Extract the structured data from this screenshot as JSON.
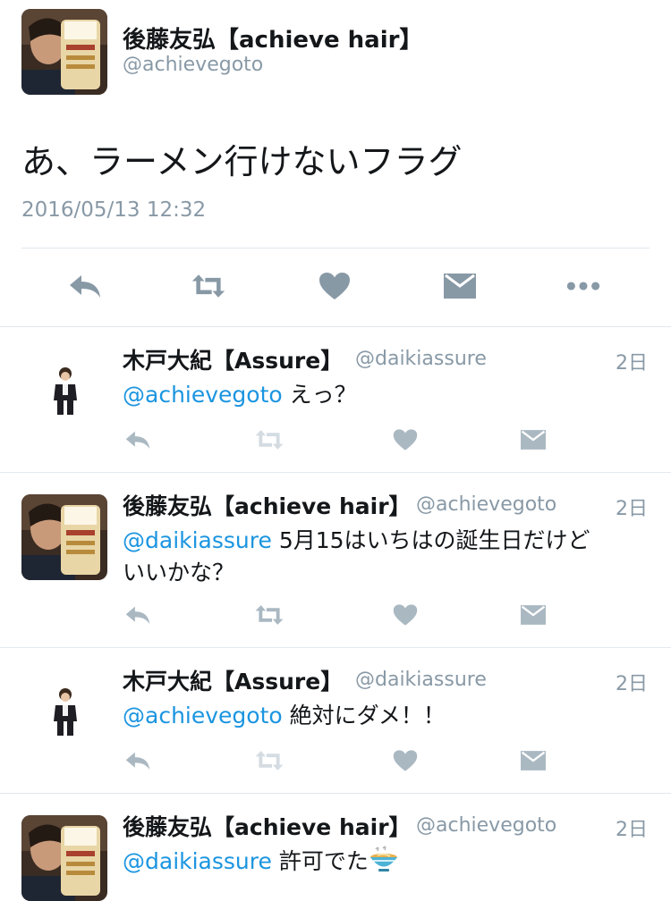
{
  "main_tweet": {
    "author_name": "後藤友弘【achieve hair】",
    "author_handle": "@achievegoto",
    "text": "あ、ラーメン行けないフラグ",
    "timestamp": "2016/05/13 12:32",
    "actions": [
      "reply-icon",
      "retweet-icon",
      "like-icon",
      "message-icon",
      "more-icon"
    ]
  },
  "replies": [
    {
      "author_name": "木戸大紀【Assure】",
      "author_handle": "@daikiassure",
      "age": "2日",
      "mention": "@achievegoto",
      "text": " えっ？"
    },
    {
      "author_name": "後藤友弘【achieve hair】",
      "author_handle": "@achievegoto",
      "age": "2日",
      "mention": "@daikiassure",
      "text": " 5月15はいちはの誕生日だけど\nいいかな？"
    },
    {
      "author_name": "木戸大紀【Assure】",
      "author_handle": "@daikiassure",
      "age": "2日",
      "mention": "@achievegoto",
      "text": " 絶対にダメ！！"
    },
    {
      "author_name": "後藤友弘【achieve hair】",
      "author_handle": "@achievegoto",
      "age": "2日",
      "mention": "@daikiassure",
      "text": " 許可でた",
      "emoji": "ramen-bowl-icon"
    }
  ],
  "colors": {
    "link": "#1b95e0",
    "muted": "#8899a6",
    "icon_main": "#8899a6",
    "icon_reply": "#aab8c2",
    "divider": "#e1e8ed"
  }
}
